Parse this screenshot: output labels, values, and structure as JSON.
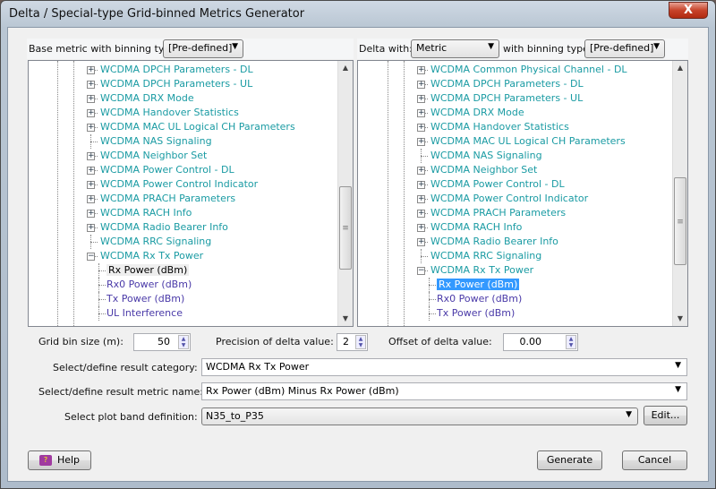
{
  "window": {
    "title": "Delta / Special-type Grid-binned Metrics Generator",
    "close_label": "X"
  },
  "left": {
    "label": "Base metric with binning type:",
    "binning": "[Pre-defined]",
    "items": [
      {
        "label": "WCDMA DPCH Parameters - DL",
        "kind": "plus"
      },
      {
        "label": "WCDMA DPCH Parameters - UL",
        "kind": "plus"
      },
      {
        "label": "WCDMA DRX Mode",
        "kind": "plus"
      },
      {
        "label": "WCDMA Handover Statistics",
        "kind": "plus"
      },
      {
        "label": "WCDMA MAC UL Logical CH Parameters",
        "kind": "plus"
      },
      {
        "label": "WCDMA NAS Signaling",
        "kind": "leaf"
      },
      {
        "label": "WCDMA Neighbor Set",
        "kind": "plus"
      },
      {
        "label": "WCDMA Power Control - DL",
        "kind": "plus"
      },
      {
        "label": "WCDMA Power Control Indicator",
        "kind": "plus"
      },
      {
        "label": "WCDMA PRACH Parameters",
        "kind": "plus"
      },
      {
        "label": "WCDMA RACH Info",
        "kind": "plus"
      },
      {
        "label": "WCDMA Radio Bearer Info",
        "kind": "plus"
      },
      {
        "label": "WCDMA RRC Signaling",
        "kind": "leaf"
      },
      {
        "label": "WCDMA Rx Tx Power",
        "kind": "minus"
      },
      {
        "label": "Rx Power (dBm)",
        "kind": "child",
        "state": "hot"
      },
      {
        "label": "Rx0 Power (dBm)",
        "kind": "child"
      },
      {
        "label": "Tx Power (dBm)",
        "kind": "child"
      },
      {
        "label": "UL Interference",
        "kind": "child"
      }
    ]
  },
  "right": {
    "delta_label": "Delta with:",
    "delta_value": "Metric",
    "binning_label": "with binning type:",
    "binning": "[Pre-defined]",
    "items": [
      {
        "label": "WCDMA Common Physical Channel - DL",
        "kind": "plus"
      },
      {
        "label": "WCDMA DPCH Parameters - DL",
        "kind": "plus"
      },
      {
        "label": "WCDMA DPCH Parameters - UL",
        "kind": "plus"
      },
      {
        "label": "WCDMA DRX Mode",
        "kind": "plus"
      },
      {
        "label": "WCDMA Handover Statistics",
        "kind": "plus"
      },
      {
        "label": "WCDMA MAC UL Logical CH Parameters",
        "kind": "plus"
      },
      {
        "label": "WCDMA NAS Signaling",
        "kind": "leaf"
      },
      {
        "label": "WCDMA Neighbor Set",
        "kind": "plus"
      },
      {
        "label": "WCDMA Power Control - DL",
        "kind": "plus"
      },
      {
        "label": "WCDMA Power Control Indicator",
        "kind": "plus"
      },
      {
        "label": "WCDMA PRACH Parameters",
        "kind": "plus"
      },
      {
        "label": "WCDMA RACH Info",
        "kind": "plus"
      },
      {
        "label": "WCDMA Radio Bearer Info",
        "kind": "plus"
      },
      {
        "label": "WCDMA RRC Signaling",
        "kind": "leaf"
      },
      {
        "label": "WCDMA Rx Tx Power",
        "kind": "minus"
      },
      {
        "label": "Rx Power (dBm)",
        "kind": "child",
        "state": "selected"
      },
      {
        "label": "Rx0 Power (dBm)",
        "kind": "child"
      },
      {
        "label": "Tx Power (dBm)",
        "kind": "child"
      }
    ]
  },
  "form": {
    "grid_bin_label": "Grid bin size (m):",
    "grid_bin_value": "50",
    "precision_label": "Precision of delta value:",
    "precision_value": "2",
    "offset_label": "Offset of delta value:",
    "offset_value": "0.00",
    "category_label": "Select/define result category:",
    "category_value": "WCDMA Rx Tx Power",
    "metric_label": "Select/define result metric name:",
    "metric_value": "Rx Power (dBm) Minus Rx Power (dBm)",
    "band_label": "Select plot band definition:",
    "band_value": "N35_to_P35",
    "edit_label": "Edit..."
  },
  "buttons": {
    "help": "Help",
    "generate": "Generate",
    "cancel": "Cancel"
  },
  "colors": {
    "group_text": "#1a9ba3",
    "child_text": "#4a3aa8",
    "selection": "#3399ff"
  }
}
